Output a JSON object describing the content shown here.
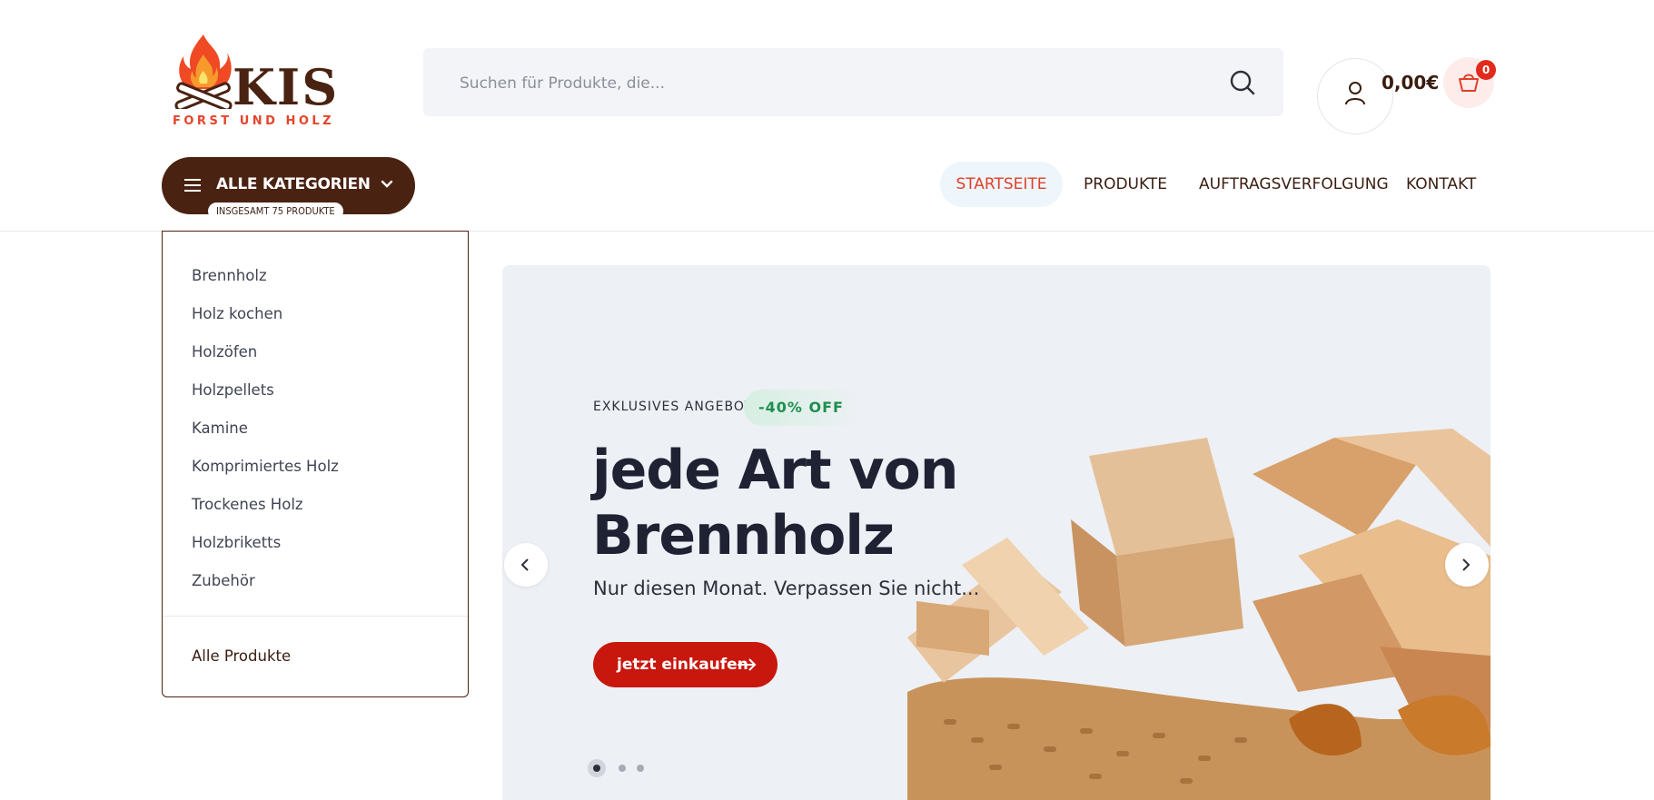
{
  "brand": {
    "name": "KIS",
    "tagline": "FORST UND HOLZ"
  },
  "search": {
    "placeholder": "Suchen für Produkte, die..."
  },
  "cart": {
    "total": "0,00€",
    "count": "0"
  },
  "categories_button": {
    "label": "ALLE KATEGORIEN",
    "total_label": "INSGESAMT 75 PRODUKTE"
  },
  "nav": {
    "items": [
      {
        "label": "STARTSEITE"
      },
      {
        "label": "PRODUKTE"
      },
      {
        "label": "AUFTRAGSVERFOLGUNG"
      },
      {
        "label": "KONTAKT"
      }
    ]
  },
  "category_menu": {
    "items": [
      {
        "label": "Brennholz"
      },
      {
        "label": "Holz kochen"
      },
      {
        "label": "Holzöfen"
      },
      {
        "label": "Holzpellets"
      },
      {
        "label": "Kamine"
      },
      {
        "label": "Komprimiertes Holz"
      },
      {
        "label": "Trockenes Holz"
      },
      {
        "label": "Holzbriketts"
      },
      {
        "label": "Zubehör"
      }
    ],
    "all_label": "Alle Produkte"
  },
  "hero": {
    "eyebrow": "EXKLUSIVES ANGEBOT",
    "badge": "-40% OFF",
    "title_line1": "jede Art von",
    "title_line2": "Brennholz",
    "subtitle": "Nur diesen Monat. Verpassen Sie nicht...",
    "cta": "jetzt einkaufen",
    "slide_count": 3,
    "active_slide": 1
  },
  "colors": {
    "brand_brown": "#4a2211",
    "accent_red": "#c8170d",
    "badge_green": "#1f8f4e"
  },
  "icons": [
    "flame-logo-icon",
    "search-icon",
    "user-icon",
    "cart-icon",
    "menu-icon",
    "chevron-down-icon",
    "chevron-left-icon",
    "chevron-right-icon",
    "arrow-right-icon"
  ]
}
